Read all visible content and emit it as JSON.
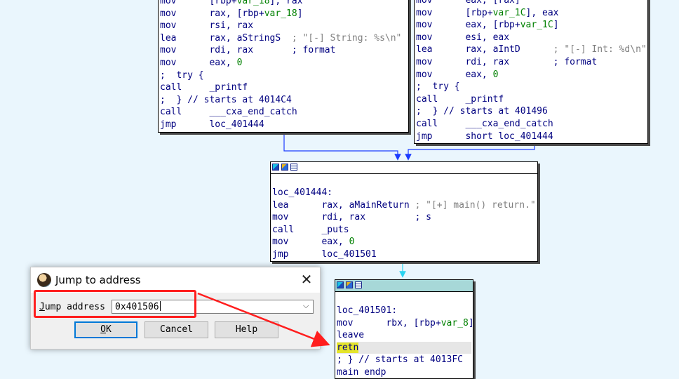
{
  "node_left": {
    "lines": [
      {
        "m": "mov",
        "ops": "[rbp+var_18], rax",
        "cmt": ""
      },
      {
        "m": "mov",
        "ops": "rax, [rbp+var_18]",
        "cmt": ""
      },
      {
        "m": "mov",
        "ops": "rsi, rax",
        "cmt": ""
      },
      {
        "m": "lea",
        "ops": "rax, aStringS  ",
        "cmt": "; \"[-] String: %s\\n\""
      },
      {
        "m": "mov",
        "ops": "rdi, rax       ",
        "cmt": "; format"
      },
      {
        "m": "mov",
        "ops": "eax, 0",
        "cmt": ""
      },
      {
        "m": "",
        "ops": ";  try {",
        "cmt": ""
      },
      {
        "m": "call",
        "ops": "_printf",
        "cmt": ""
      },
      {
        "m": "",
        "ops": ";  } // starts at 4014C4",
        "cmt": ""
      },
      {
        "m": "call",
        "ops": "___cxa_end_catch",
        "cmt": ""
      },
      {
        "m": "jmp",
        "ops": "loc_401444",
        "cmt": ""
      }
    ]
  },
  "node_right": {
    "lines": [
      {
        "m": "mov",
        "ops": "eax, [rax]",
        "cmt": ""
      },
      {
        "m": "mov",
        "ops": "[rbp+var_1C], eax",
        "cmt": ""
      },
      {
        "m": "mov",
        "ops": "eax, [rbp+var_1C]",
        "cmt": ""
      },
      {
        "m": "mov",
        "ops": "esi, eax",
        "cmt": ""
      },
      {
        "m": "lea",
        "ops": "rax, aIntD      ",
        "cmt": "; \"[-] Int: %d\\n\""
      },
      {
        "m": "mov",
        "ops": "rdi, rax        ",
        "cmt": "; format"
      },
      {
        "m": "mov",
        "ops": "eax, 0",
        "cmt": ""
      },
      {
        "m": "",
        "ops": ";  try {",
        "cmt": ""
      },
      {
        "m": "call",
        "ops": "_printf",
        "cmt": ""
      },
      {
        "m": "",
        "ops": ";  } // starts at 401496",
        "cmt": ""
      },
      {
        "m": "call",
        "ops": "___cxa_end_catch",
        "cmt": ""
      },
      {
        "m": "jmp",
        "ops": "short loc_401444",
        "cmt": ""
      }
    ]
  },
  "node_middle": {
    "label": "loc_401444:",
    "lines": [
      {
        "m": "lea",
        "ops": "rax, aMainReturn ",
        "cmt": "; \"[+] main() return.\""
      },
      {
        "m": "mov",
        "ops": "rdi, rax         ",
        "cmt": "; s"
      },
      {
        "m": "call",
        "ops": "_puts",
        "cmt": ""
      },
      {
        "m": "mov",
        "ops": "eax, 0",
        "cmt": ""
      },
      {
        "m": "jmp",
        "ops": "loc_401501",
        "cmt": ""
      }
    ]
  },
  "node_bottom": {
    "label": "loc_401501:",
    "lines": [
      {
        "m": "mov",
        "ops": "rbx, [rbp+var_8]",
        "cmt": ""
      },
      {
        "m": "leave",
        "ops": "",
        "cmt": ""
      }
    ],
    "retn": "retn",
    "tail": [
      "; } // starts at 4013FC",
      "main endp"
    ]
  },
  "dialog": {
    "title": "Jump to address",
    "close_glyph": "✕",
    "label_prefix": "J",
    "label_rest": "ump address",
    "input_value": "0x401506",
    "dropdown_glyph": "⌵",
    "ok_prefix": "O",
    "ok_rest": "K",
    "cancel_label": "Cancel",
    "help_label": "Help"
  },
  "colors": {
    "background": "#eaf6fd",
    "code_text": "#000080",
    "comment": "#808080",
    "number": "#008000",
    "edge_blue": "#1c3cff",
    "edge_cyan": "#2ad4f0",
    "annotation_red": "#ff1e1e",
    "retn_highlight": "#e5e52b"
  },
  "icons": [
    "graph-node-icon",
    "edit-node-icon",
    "list-node-icon",
    "ida-app-icon",
    "close-icon",
    "chevron-down-icon"
  ]
}
